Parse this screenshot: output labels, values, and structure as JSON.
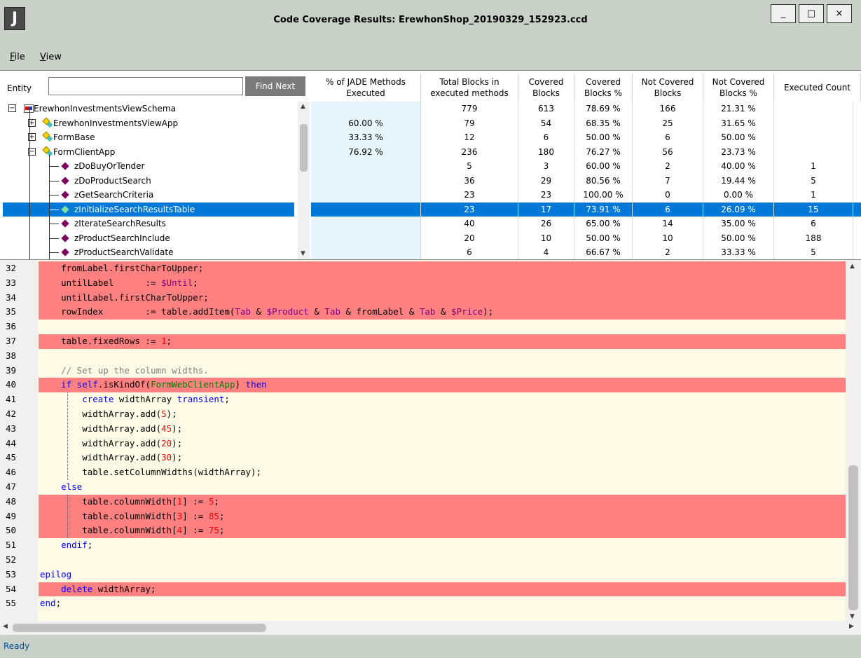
{
  "window": {
    "icon_letter": "J",
    "title": "Code Coverage Results: ErewhonShop_20190329_152923.ccd",
    "min_glyph": "_",
    "max_glyph": "□",
    "close_glyph": "×"
  },
  "menu": {
    "file": {
      "accel": "F",
      "rest": "ile"
    },
    "view": {
      "accel": "V",
      "rest": "iew"
    }
  },
  "search": {
    "label": "Entity",
    "value": "",
    "button": "Find Next"
  },
  "columns": [
    "% of JADE Methods Executed",
    "Total Blocks in executed methods",
    "Covered Blocks",
    "Covered Blocks %",
    "Not Covered Blocks",
    "Not Covered Blocks %",
    "Executed Count"
  ],
  "tree": [
    {
      "label": "ErewhonInvestmentsViewSchema",
      "level": 0,
      "icon": "schema-icon",
      "expander": "−"
    },
    {
      "label": "ErewhonInvestmentsViewApp",
      "level": 1,
      "icon": "class-icon",
      "expander": "+"
    },
    {
      "label": "FormBase",
      "level": 1,
      "icon": "class-icon",
      "expander": "+"
    },
    {
      "label": "FormClientApp",
      "level": 1,
      "icon": "class-icon",
      "expander": "−"
    },
    {
      "label": "zDoBuyOrTender",
      "level": 2,
      "icon": "method-icon"
    },
    {
      "label": "zDoProductSearch",
      "level": 2,
      "icon": "method-icon"
    },
    {
      "label": "zGetSearchCriteria",
      "level": 2,
      "icon": "method-icon"
    },
    {
      "label": "zInitializeSearchResultsTable",
      "level": 2,
      "icon": "method-icon",
      "selected": true
    },
    {
      "label": "zIterateSearchResults",
      "level": 2,
      "icon": "method-icon"
    },
    {
      "label": "zProductSearchInclude",
      "level": 2,
      "icon": "method-icon"
    },
    {
      "label": "zProductSearchValidate",
      "level": 2,
      "icon": "method-icon"
    }
  ],
  "rows": [
    [
      "",
      "779",
      "613",
      "78.69 %",
      "166",
      "21.31 %",
      ""
    ],
    [
      "60.00 %",
      "79",
      "54",
      "68.35 %",
      "25",
      "31.65 %",
      ""
    ],
    [
      "33.33 %",
      "12",
      "6",
      "50.00 %",
      "6",
      "50.00 %",
      ""
    ],
    [
      "76.92 %",
      "236",
      "180",
      "76.27 %",
      "56",
      "23.73 %",
      ""
    ],
    [
      "",
      "5",
      "3",
      "60.00 %",
      "2",
      "40.00 %",
      "1"
    ],
    [
      "",
      "36",
      "29",
      "80.56 %",
      "7",
      "19.44 %",
      "5"
    ],
    [
      "",
      "23",
      "23",
      "100.00 %",
      "0",
      "0.00 %",
      "1"
    ],
    [
      "",
      "23",
      "17",
      "73.91 %",
      "6",
      "26.09 %",
      "15"
    ],
    [
      "",
      "40",
      "26",
      "65.00 %",
      "14",
      "35.00 %",
      "6"
    ],
    [
      "",
      "20",
      "10",
      "50.00 %",
      "10",
      "50.00 %",
      "188"
    ],
    [
      "",
      "6",
      "4",
      "66.67 %",
      "2",
      "33.33 %",
      "5"
    ]
  ],
  "code": [
    {
      "n": "32",
      "red": true,
      "tokens": [
        [
          "",
          "    fromLabel.firstCharToUpper;"
        ]
      ]
    },
    {
      "n": "33",
      "red": true,
      "tokens": [
        [
          "",
          "    untilLabel      := "
        ],
        [
          "str",
          "$Until"
        ],
        [
          "",
          ";"
        ]
      ]
    },
    {
      "n": "34",
      "red": true,
      "tokens": [
        [
          "",
          "    untilLabel.firstCharToUpper;"
        ]
      ]
    },
    {
      "n": "35",
      "red": true,
      "tokens": [
        [
          "",
          "    rowIndex        := table.addItem("
        ],
        [
          "str",
          "Tab"
        ],
        [
          "",
          " & "
        ],
        [
          "str",
          "$Product"
        ],
        [
          "",
          " & "
        ],
        [
          "str",
          "Tab"
        ],
        [
          "",
          " & fromLabel & "
        ],
        [
          "str",
          "Tab"
        ],
        [
          "",
          " & "
        ],
        [
          "str",
          "$Price"
        ],
        [
          "",
          ");"
        ]
      ]
    },
    {
      "n": "36",
      "red": false,
      "tokens": [
        [
          "",
          ""
        ]
      ]
    },
    {
      "n": "37",
      "red": true,
      "tokens": [
        [
          "",
          "    table.fixedRows := "
        ],
        [
          "num",
          "1"
        ],
        [
          "",
          ";"
        ]
      ]
    },
    {
      "n": "38",
      "red": false,
      "tokens": [
        [
          "",
          ""
        ]
      ]
    },
    {
      "n": "39",
      "red": false,
      "tokens": [
        [
          "cmt",
          "    // Set up the column widths."
        ]
      ]
    },
    {
      "n": "40",
      "red": true,
      "tokens": [
        [
          "",
          "    "
        ],
        [
          "kw",
          "if"
        ],
        [
          "",
          " "
        ],
        [
          "kw",
          "self"
        ],
        [
          "",
          ".isKindOf("
        ],
        [
          "cls",
          "FormWebClientApp"
        ],
        [
          "",
          ") "
        ],
        [
          "kw",
          "then"
        ]
      ]
    },
    {
      "n": "41",
      "red": false,
      "tokens": [
        [
          "",
          "        "
        ],
        [
          "kw",
          "create"
        ],
        [
          "",
          " widthArray "
        ],
        [
          "kw",
          "transient"
        ],
        [
          "",
          ";"
        ]
      ]
    },
    {
      "n": "42",
      "red": false,
      "tokens": [
        [
          "",
          "        widthArray.add("
        ],
        [
          "num",
          "5"
        ],
        [
          "",
          ");"
        ]
      ]
    },
    {
      "n": "43",
      "red": false,
      "tokens": [
        [
          "",
          "        widthArray.add("
        ],
        [
          "num",
          "45"
        ],
        [
          "",
          ");"
        ]
      ]
    },
    {
      "n": "44",
      "red": false,
      "tokens": [
        [
          "",
          "        widthArray.add("
        ],
        [
          "num",
          "20"
        ],
        [
          "",
          ");"
        ]
      ]
    },
    {
      "n": "45",
      "red": false,
      "tokens": [
        [
          "",
          "        widthArray.add("
        ],
        [
          "num",
          "30"
        ],
        [
          "",
          ");"
        ]
      ]
    },
    {
      "n": "46",
      "red": false,
      "tokens": [
        [
          "",
          "        table.setColumnWidths(widthArray);"
        ]
      ]
    },
    {
      "n": "47",
      "red": false,
      "tokens": [
        [
          "",
          "    "
        ],
        [
          "kw",
          "else"
        ]
      ]
    },
    {
      "n": "48",
      "red": true,
      "tokens": [
        [
          "",
          "        table.columnWidth["
        ],
        [
          "num",
          "1"
        ],
        [
          "",
          "] := "
        ],
        [
          "num",
          "5"
        ],
        [
          "",
          ";"
        ]
      ]
    },
    {
      "n": "49",
      "red": true,
      "tokens": [
        [
          "",
          "        table.columnWidth["
        ],
        [
          "num",
          "3"
        ],
        [
          "",
          "] := "
        ],
        [
          "num",
          "85"
        ],
        [
          "",
          ";"
        ]
      ]
    },
    {
      "n": "50",
      "red": true,
      "tokens": [
        [
          "",
          "        table.columnWidth["
        ],
        [
          "num",
          "4"
        ],
        [
          "",
          "] := "
        ],
        [
          "num",
          "75"
        ],
        [
          "",
          ";"
        ]
      ]
    },
    {
      "n": "51",
      "red": false,
      "tokens": [
        [
          "",
          "    "
        ],
        [
          "kw",
          "endif"
        ],
        [
          "",
          ";"
        ]
      ]
    },
    {
      "n": "52",
      "red": false,
      "tokens": [
        [
          "",
          ""
        ]
      ]
    },
    {
      "n": "53",
      "red": false,
      "tokens": [
        [
          "kw",
          "epilog"
        ]
      ]
    },
    {
      "n": "54",
      "red": true,
      "tokens": [
        [
          "",
          "    "
        ],
        [
          "kw",
          "delete"
        ],
        [
          "",
          " widthArray;"
        ]
      ]
    },
    {
      "n": "55",
      "red": false,
      "tokens": [
        [
          "kw",
          "end"
        ],
        [
          "",
          ";"
        ]
      ]
    }
  ],
  "status": "Ready",
  "colors": {
    "selection": "#0078d7",
    "uncovered": "#ff8080",
    "editor_bg": "#fdfbe6",
    "chrome": "#c8d0c8",
    "keyword": "#0000ff",
    "string": "#800080",
    "number": "#ff0000"
  }
}
